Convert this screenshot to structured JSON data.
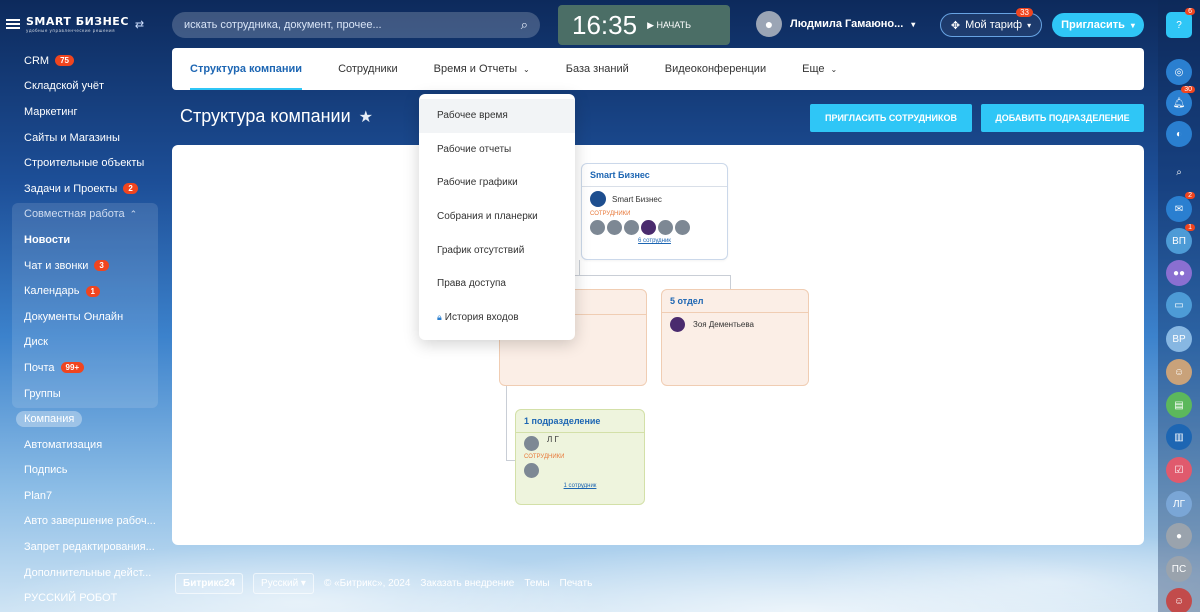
{
  "logo": {
    "name": "SMART БИЗНЕС",
    "sub": "удобные управленческие решения"
  },
  "sidebar": {
    "items": [
      {
        "label": "CRM",
        "count": "75"
      },
      {
        "label": "Складской учёт"
      },
      {
        "label": "Маркетинг"
      },
      {
        "label": "Сайты и Магазины"
      },
      {
        "label": "Строительные объекты"
      },
      {
        "label": "Задачи и Проекты",
        "count": "2"
      },
      {
        "label": "Совместная работа"
      },
      {
        "label": "Новости"
      },
      {
        "label": "Чат и звонки",
        "count": "3"
      },
      {
        "label": "Календарь",
        "count": "1"
      },
      {
        "label": "Документы Онлайн"
      },
      {
        "label": "Диск"
      },
      {
        "label": "Почта",
        "count": "99+"
      },
      {
        "label": "Группы"
      },
      {
        "label": "Компания"
      },
      {
        "label": "Автоматизация"
      },
      {
        "label": "Подпись"
      },
      {
        "label": "Plan7"
      },
      {
        "label": "Авто завершение рабоч..."
      },
      {
        "label": "Запрет редактирования..."
      },
      {
        "label": "Дополнительные дейст..."
      },
      {
        "label": "РУССКИЙ РОБОТ"
      }
    ]
  },
  "search": {
    "placeholder": "искать сотрудника, документ, прочее..."
  },
  "clock": {
    "time": "16:35",
    "start": "НАЧАТЬ"
  },
  "user": {
    "name": "Людмила Гамаюно..."
  },
  "tariff": {
    "label": "Мой тариф",
    "badge": "33"
  },
  "invite": {
    "label": "Пригласить"
  },
  "rightbar": {
    "badges": {
      "top": "6",
      "bell": "30",
      "chat": "2",
      "vp": "1"
    },
    "vp": "ВП",
    "vr": "ВР",
    "lg": "ЛГ",
    "ps": "ПС"
  },
  "tabs": [
    "Структура компании",
    "Сотрудники",
    "Время и Отчеты",
    "База знаний",
    "Видеоконференции",
    "Еще"
  ],
  "page": {
    "title": "Структура компании",
    "btn_invite": "ПРИГЛАСИТЬ СОТРУДНИКОВ",
    "btn_add": "ДОБАВИТЬ ПОДРАЗДЕЛЕНИЕ"
  },
  "dropdown": [
    "Рабочее время",
    "Рабочие отчеты",
    "Рабочие графики",
    "Собрания и планерки",
    "График отсутствий",
    "Права доступа",
    "История входов"
  ],
  "structure": {
    "root": {
      "title": "Smart Бизнес",
      "head": "Smart Бизнес",
      "emp_label": "СОТРУДНИКИ",
      "count": "6 сотрудник"
    },
    "dept_hidden": {
      "person_tail": "ова"
    },
    "dept5": {
      "title": "5 отдел",
      "person": "Зоя Дементьева"
    },
    "dept1": {
      "title": "1 подразделение",
      "person": "Л Г",
      "emp_label": "СОТРУДНИКИ",
      "count": "1 сотрудник"
    }
  },
  "footer": {
    "brand": "Битрикс24",
    "lang": "Русский",
    "copy": "© «Битрикс», 2024",
    "order": "Заказать внедрение",
    "themes": "Темы",
    "print": "Печать"
  }
}
